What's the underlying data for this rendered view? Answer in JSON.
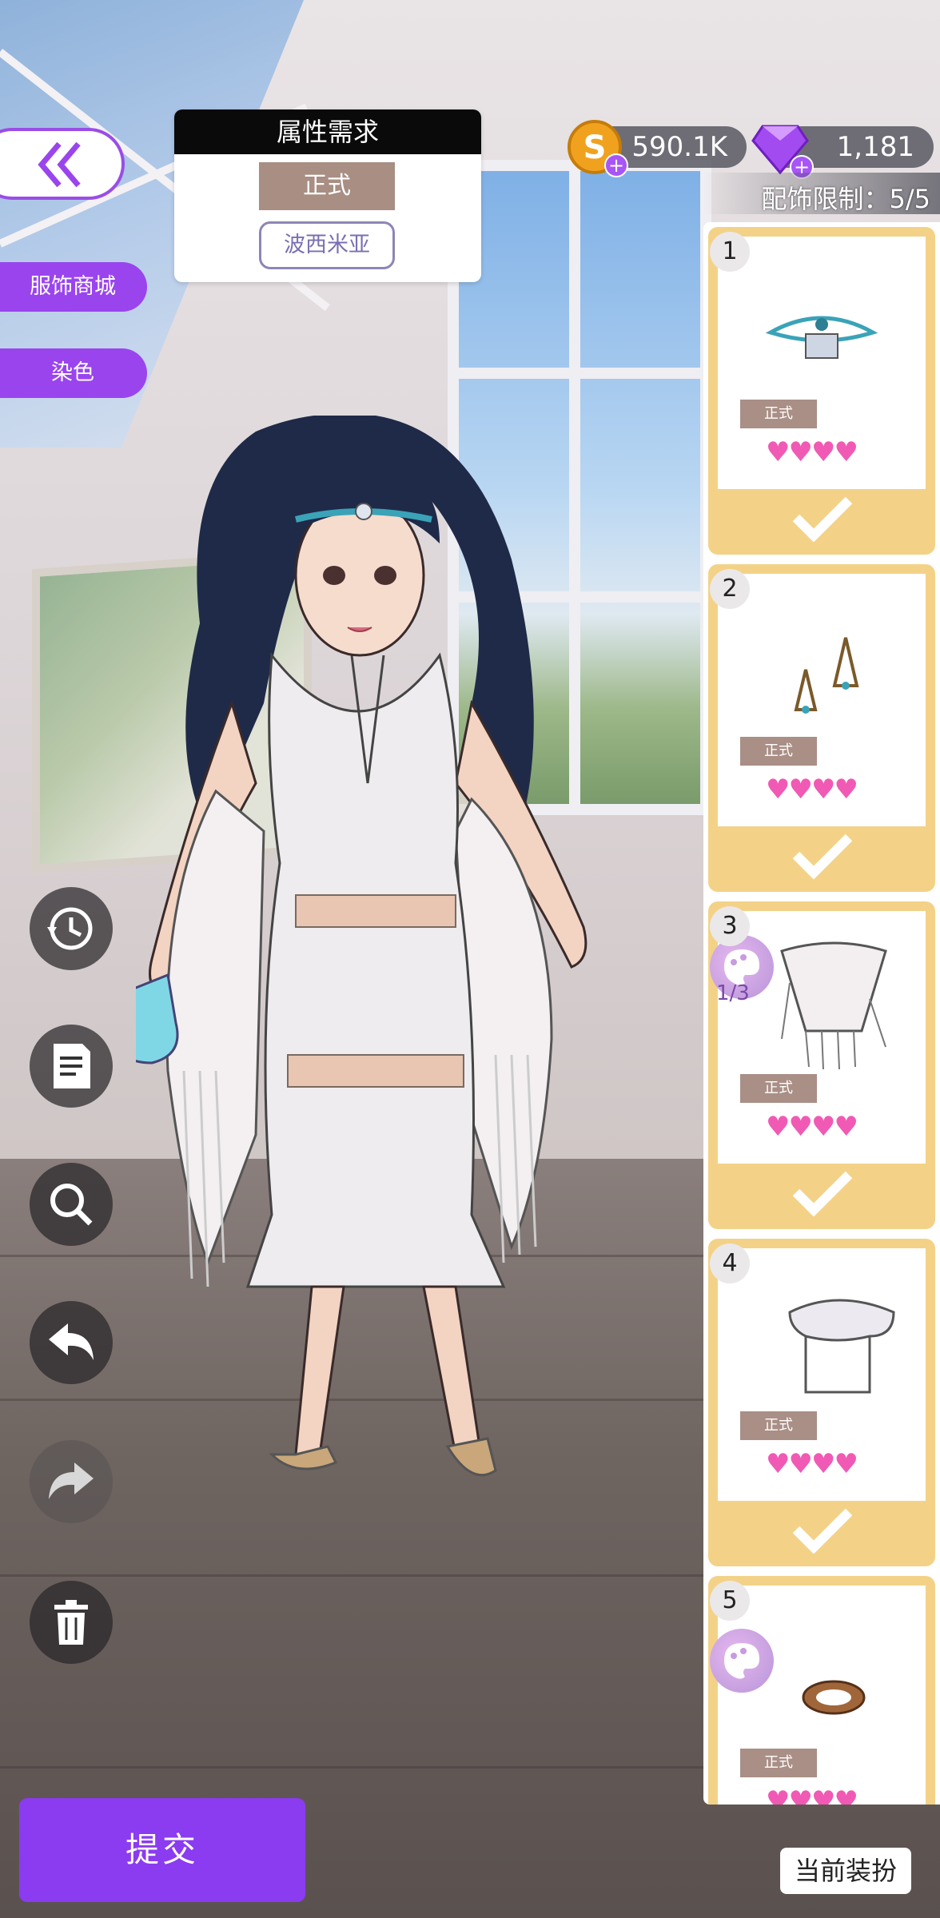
{
  "currency": {
    "coins": "590.1K",
    "gems": "1,181"
  },
  "accessory_limit": "配饰限制：5/5",
  "requirements": {
    "title": "属性需求",
    "tag_primary": "正式",
    "tag_secondary": "波西米亚"
  },
  "left_menu": {
    "shop_label": "服饰商城",
    "dye_label": "染色"
  },
  "items": [
    {
      "number": "1",
      "tag": "正式",
      "hearts": "♥♥♥♥",
      "selected": true
    },
    {
      "number": "2",
      "tag": "正式",
      "hearts": "♥♥♥♥",
      "selected": true
    },
    {
      "number": "3",
      "tag": "正式",
      "hearts": "♥♥♥♥",
      "selected": true,
      "dye_count": "1/3"
    },
    {
      "number": "4",
      "tag": "正式",
      "hearts": "♥♥♥♥",
      "selected": true
    },
    {
      "number": "5",
      "tag": "正式",
      "hearts": "♥♥♥♥"
    }
  ],
  "buttons": {
    "submit": "提交",
    "current_outfit": "当前装扮"
  },
  "colors": {
    "accent_purple": "#9a44ee",
    "item_card_yellow": "#f3d288",
    "heart_pink": "#f05ab4",
    "tag_brown": "#a98f86"
  }
}
